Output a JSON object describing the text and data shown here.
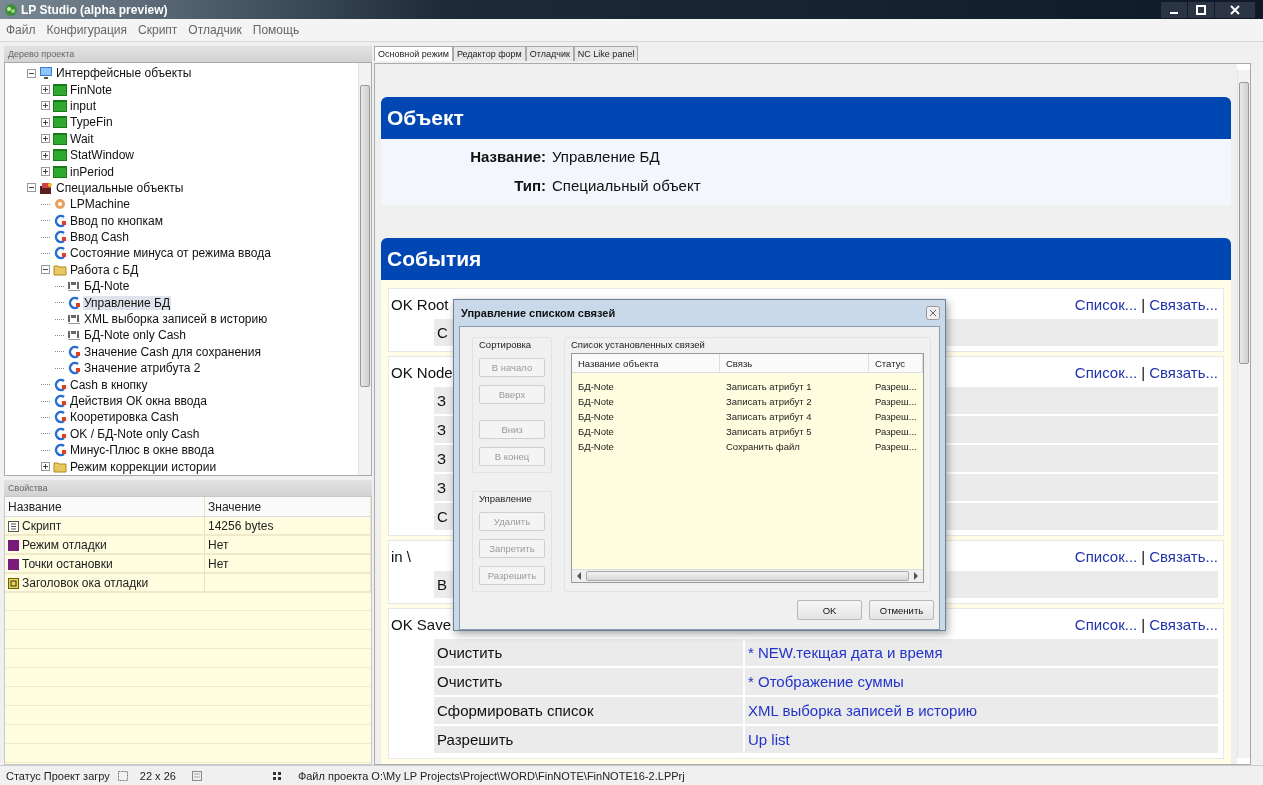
{
  "window": {
    "title": "LP Studio (alpha preview)"
  },
  "menu": [
    "Файл",
    "Конфигурация",
    "Скрипт",
    "Отладчик",
    "Помощь"
  ],
  "project_tree": {
    "title": "Дерево проекта",
    "items": [
      {
        "label": "Интерфейсные объекты",
        "kind": "monitor",
        "expanded": true,
        "selected": false,
        "children": [
          {
            "label": "FinNote",
            "kind": "form",
            "expanded": false,
            "selected": false
          },
          {
            "label": "input",
            "kind": "form",
            "expanded": false,
            "selected": false
          },
          {
            "label": "TypeFin",
            "kind": "form",
            "expanded": false,
            "selected": false
          },
          {
            "label": "Wait",
            "kind": "form",
            "expanded": false,
            "selected": false
          },
          {
            "label": "StatWindow",
            "kind": "form",
            "expanded": false,
            "selected": false
          },
          {
            "label": "inPeriod",
            "kind": "form",
            "expanded": false,
            "selected": false
          }
        ]
      },
      {
        "label": "Специальные объекты",
        "kind": "special",
        "expanded": true,
        "selected": false,
        "children": [
          {
            "label": "LPMachine",
            "kind": "machine",
            "selected": false
          },
          {
            "label": "Ввод по кнопкам",
            "kind": "script",
            "selected": false
          },
          {
            "label": "Ввод Cash",
            "kind": "script",
            "selected": false
          },
          {
            "label": "Состояние минуса от режима ввода",
            "kind": "script",
            "selected": false
          },
          {
            "label": "Работа с БД",
            "kind": "folder",
            "expanded": true,
            "selected": false,
            "children": [
              {
                "label": "БД-Note",
                "kind": "iml",
                "selected": false
              },
              {
                "label": "Управление БД",
                "kind": "script",
                "selected": true
              },
              {
                "label": "XML выборка записей в историю",
                "kind": "iml",
                "selected": false
              },
              {
                "label": "БД-Note only Cash",
                "kind": "iml",
                "selected": false
              },
              {
                "label": "Значение Cash для сохранения",
                "kind": "script",
                "selected": false
              },
              {
                "label": "Значение атрибута 2",
                "kind": "script",
                "selected": false
              }
            ]
          },
          {
            "label": "Cash в кнопку",
            "kind": "script",
            "selected": false
          },
          {
            "label": "Действия ОК окна ввода",
            "kind": "script",
            "selected": false
          },
          {
            "label": "Кооретировка Cash",
            "kind": "script",
            "selected": false
          },
          {
            "label": "OK / БД-Note only Cash",
            "kind": "script",
            "selected": false
          },
          {
            "label": "Минус-Плюс в окне ввода",
            "kind": "script",
            "selected": false
          },
          {
            "label": "Режим коррекции истории",
            "kind": "folder",
            "expanded": false,
            "selected": false
          }
        ]
      }
    ]
  },
  "properties": {
    "title": "Свойства",
    "columns": [
      "Название",
      "Значение"
    ],
    "rows": [
      {
        "kind": "script",
        "name": "Скрипт",
        "value": "14256 bytes"
      },
      {
        "kind": "bool",
        "name": "Режим отладки",
        "value": "Нет"
      },
      {
        "kind": "bool",
        "name": "Точки остановки",
        "value": "Нет"
      },
      {
        "kind": "string",
        "name": "Заголовок ока отладки"
      }
    ]
  },
  "tabs": [
    {
      "label": "Основной режим",
      "selected": true
    },
    {
      "label": "Редактор форм",
      "selected": false
    },
    {
      "label": "Отладчик",
      "selected": false
    },
    {
      "label": "NC Like panel",
      "selected": false
    }
  ],
  "object_section": {
    "title": "Объект",
    "fields": [
      {
        "label": "Название:",
        "value": "Управление БД"
      },
      {
        "label": "Тип:",
        "value": "Специальный объект"
      }
    ]
  },
  "events_section": {
    "title": "События",
    "events": [
      {
        "name": "OK Root",
        "links": [
          "Список...",
          "Связать..."
        ],
        "separator": "|",
        "actions": [
          {
            "action": "С"
          }
        ]
      },
      {
        "name": "OK Node",
        "links": [
          "Список...",
          "Связать..."
        ],
        "separator": "|",
        "actions": [
          {
            "action": "З"
          },
          {
            "action": "З"
          },
          {
            "action": "З"
          },
          {
            "action": "З"
          },
          {
            "action": "С"
          }
        ]
      },
      {
        "name": "in \\",
        "links": [
          "Список...",
          "Связать..."
        ],
        "separator": "|",
        "actions": [
          {
            "action": "В"
          }
        ]
      },
      {
        "name": "OK Save",
        "links": [
          "Список...",
          "Связать..."
        ],
        "separator": "|",
        "actions": [
          {
            "action": "Очистить",
            "target": "* NEW.текщая дата и время"
          },
          {
            "action": "Очистить",
            "target": "* Отображение суммы"
          },
          {
            "action": "Сформировать список",
            "target": "XML выборка записей в историю"
          },
          {
            "action": "Разрешить",
            "target": "Up list"
          }
        ]
      }
    ]
  },
  "dialog": {
    "title": "Управление списком связей",
    "groups": [
      {
        "title": "Сортировка",
        "buttons": [
          {
            "label": "В начало",
            "disabled": true
          },
          {
            "label": "Вверх",
            "disabled": true
          },
          {
            "label": "Вниз",
            "disabled": true
          },
          {
            "label": "В конец",
            "disabled": true
          }
        ]
      },
      {
        "title": "Управление",
        "buttons": [
          {
            "label": "Удалить",
            "disabled": true
          },
          {
            "label": "Запретить",
            "disabled": true
          },
          {
            "label": "Разрешить",
            "disabled": true
          }
        ]
      }
    ],
    "list_title": "Список установленных связей",
    "columns": [
      "Название объекта",
      "Связь",
      "Статус"
    ],
    "rows": [
      {
        "object": "БД-Note",
        "link": "Записать атрибут 1",
        "status": "Разреш..."
      },
      {
        "object": "БД-Note",
        "link": "Записать атрибут 2",
        "status": "Разреш..."
      },
      {
        "object": "БД-Note",
        "link": "Записать атрибут 4",
        "status": "Разреш..."
      },
      {
        "object": "БД-Note",
        "link": "Записать атрибут 5",
        "status": "Разреш..."
      },
      {
        "object": "БД-Note",
        "link": "Сохранить файл",
        "status": "Разреш..."
      }
    ],
    "buttons": [
      {
        "label": "OK",
        "disabled": false
      },
      {
        "label": "Отменить",
        "disabled": false
      }
    ]
  },
  "status_bar": {
    "status": "Статус Проект загру",
    "size": "22 x 26",
    "file": "Файл проекта O:\\My LP Projects\\Project\\WORD\\FinNOTE\\FinNOTE16-2.LPPrj"
  }
}
